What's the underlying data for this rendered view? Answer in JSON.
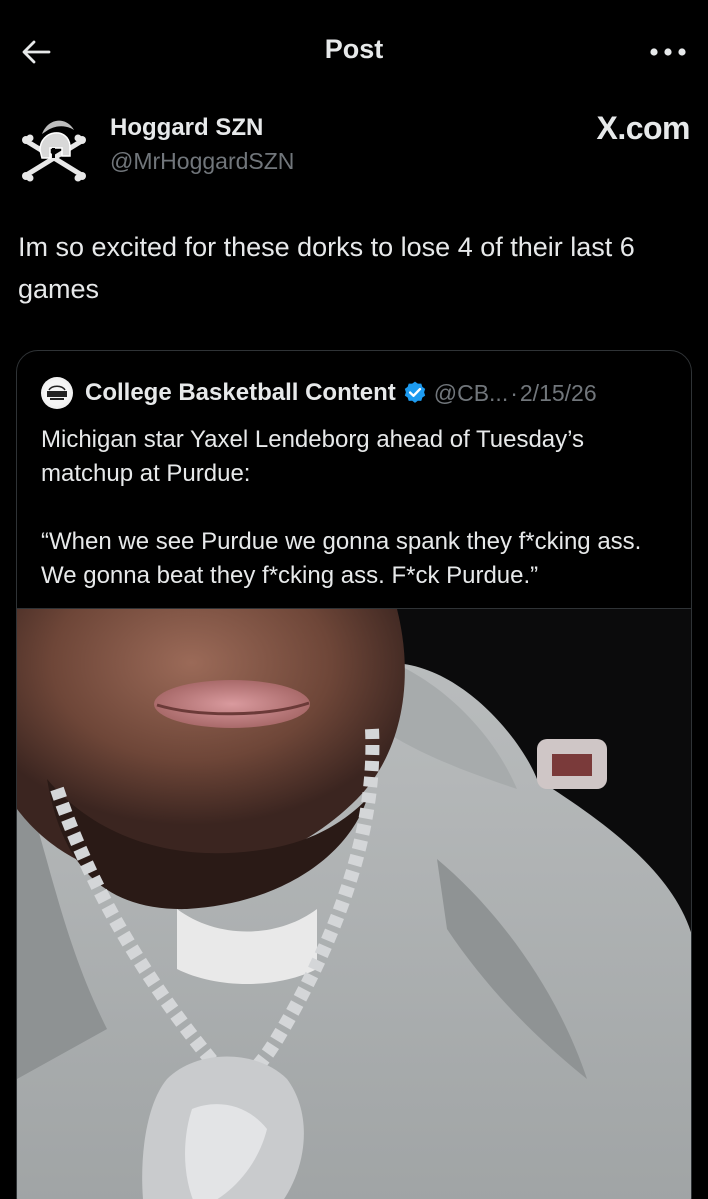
{
  "header": {
    "title": "Post"
  },
  "author": {
    "name": "Hoggard SZN",
    "handle": "@MrHoggardSZN"
  },
  "watermark": "X.com",
  "post": {
    "text": "Im so excited for these dorks to lose 4 of their last 6 games"
  },
  "quote": {
    "avatar_text": "CBB CONTENT",
    "name": "College Basketball Content",
    "handle": "@CB...",
    "separator": "·",
    "date": "2/15/26",
    "paragraphs": [
      "Michigan star Yaxel Lendeborg ahead of Tuesday’s matchup at Purdue:",
      "“When we see Purdue we gonna spank they f*cking ass. We gonna beat they f*cking ass. F*ck Purdue.”"
    ]
  },
  "icons": {
    "back": "back-arrow-icon",
    "more": "more-horizontal-icon",
    "verified": "verified-badge-icon"
  },
  "colors": {
    "background": "#000000",
    "text": "#e7e9ea",
    "secondary_text": "#71767b",
    "border": "#2f3336",
    "verified": "#1d9bf0"
  }
}
